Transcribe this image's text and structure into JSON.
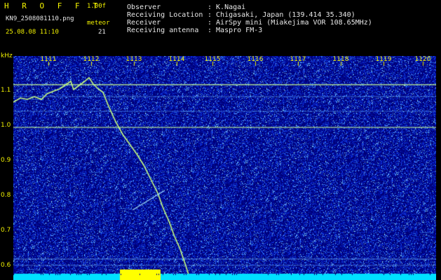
{
  "program": {
    "name": "H R O F F T",
    "version": "1.00f"
  },
  "file": {
    "name": "KN9_2508081110.png",
    "meteor_label": "meteor",
    "meteor_count": "21",
    "datetime": "25.08.08 11:10"
  },
  "info": {
    "observer_label": "Observer",
    "observer_value": ": K.Nagai",
    "location_label": "Receiving Location",
    "location_value": ": Chigasaki, Japan (139.414 35.340)",
    "receiver_label": "Receiver",
    "receiver_value": ": AirSpy mini (Miakejima VOR 108.65MHz)",
    "antenna_label": "Receiving antenna",
    "antenna_value": ": Maspro FM-3"
  },
  "axis": {
    "y_unit": "kHz",
    "y_ticks": [
      "1.1",
      "1.0",
      "0.9",
      "0.8",
      "0.7",
      "0.6"
    ],
    "x_ticks": [
      "1111",
      "1112",
      "1113",
      "1114",
      "1115",
      "1116",
      "1117",
      "1118",
      "1119",
      "1120"
    ]
  },
  "colors": {
    "text": "#f0f000",
    "background": "#000080",
    "trace": "#c8ff80",
    "baseline": "#00e0ff",
    "burst": "#ffff00"
  }
}
